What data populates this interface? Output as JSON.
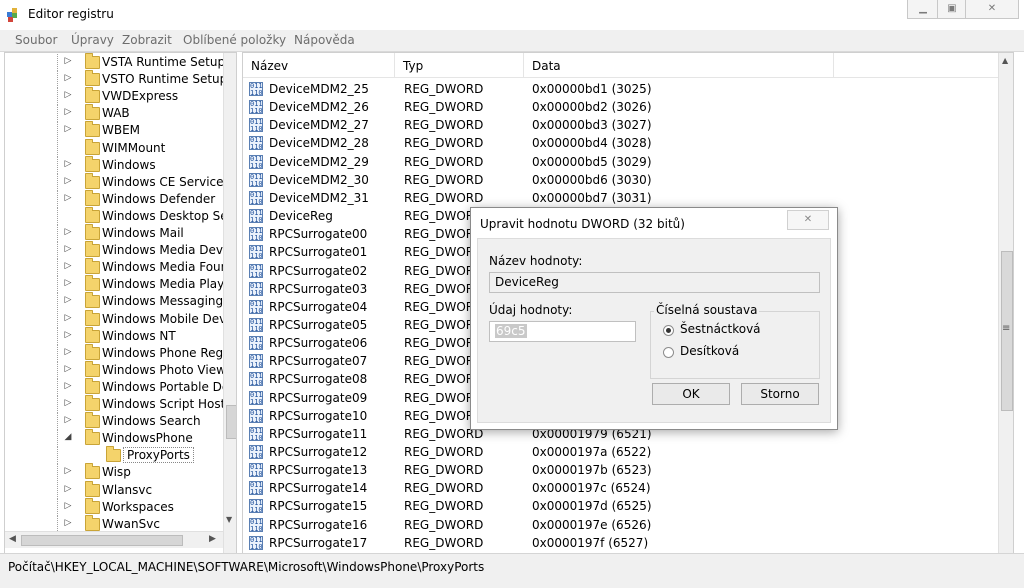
{
  "window": {
    "title": "Editor registru"
  },
  "menu": [
    "Soubor",
    "Úpravy",
    "Zobrazit",
    "Oblíbené položky",
    "Nápověda"
  ],
  "tree": {
    "items": [
      {
        "label": "VSTA Runtime Setup",
        "arrow": "▷"
      },
      {
        "label": "VSTO Runtime Setup",
        "arrow": "▷"
      },
      {
        "label": "VWDExpress",
        "arrow": "▷"
      },
      {
        "label": "WAB",
        "arrow": "▷"
      },
      {
        "label": "WBEM",
        "arrow": "▷"
      },
      {
        "label": "WIMMount",
        "arrow": ""
      },
      {
        "label": "Windows",
        "arrow": "▷"
      },
      {
        "label": "Windows CE Services",
        "arrow": "▷"
      },
      {
        "label": "Windows Defender",
        "arrow": "▷"
      },
      {
        "label": "Windows Desktop Se",
        "arrow": ""
      },
      {
        "label": "Windows Mail",
        "arrow": "▷"
      },
      {
        "label": "Windows Media Devi",
        "arrow": "▷"
      },
      {
        "label": "Windows Media Foun",
        "arrow": "▷"
      },
      {
        "label": "Windows Media Playe",
        "arrow": "▷"
      },
      {
        "label": "Windows Messaging",
        "arrow": "▷"
      },
      {
        "label": "Windows Mobile Dev",
        "arrow": "▷"
      },
      {
        "label": "Windows NT",
        "arrow": "▷"
      },
      {
        "label": "Windows Phone Reg",
        "arrow": "▷"
      },
      {
        "label": "Windows Photo View",
        "arrow": "▷"
      },
      {
        "label": "Windows Portable De",
        "arrow": "▷"
      },
      {
        "label": "Windows Script Host",
        "arrow": "▷"
      },
      {
        "label": "Windows Search",
        "arrow": "▷"
      },
      {
        "label": "WindowsPhone",
        "arrow": "◢"
      },
      {
        "label": "ProxyPorts",
        "arrow": ""
      },
      {
        "label": "Wisp",
        "arrow": "▷"
      },
      {
        "label": "Wlansvc",
        "arrow": "▷"
      },
      {
        "label": "Workspaces",
        "arrow": "▷"
      },
      {
        "label": "WwanSvc",
        "arrow": "▷"
      }
    ]
  },
  "list": {
    "columns": [
      "Název",
      "Typ",
      "Data"
    ],
    "rows": [
      {
        "name": "DeviceMDM2_25",
        "type": "REG_DWORD",
        "data": "0x00000bd1 (3025)"
      },
      {
        "name": "DeviceMDM2_26",
        "type": "REG_DWORD",
        "data": "0x00000bd2 (3026)"
      },
      {
        "name": "DeviceMDM2_27",
        "type": "REG_DWORD",
        "data": "0x00000bd3 (3027)"
      },
      {
        "name": "DeviceMDM2_28",
        "type": "REG_DWORD",
        "data": "0x00000bd4 (3028)"
      },
      {
        "name": "DeviceMDM2_29",
        "type": "REG_DWORD",
        "data": "0x00000bd5 (3029)"
      },
      {
        "name": "DeviceMDM2_30",
        "type": "REG_DWORD",
        "data": "0x00000bd6 (3030)"
      },
      {
        "name": "DeviceMDM2_31",
        "type": "REG_DWORD",
        "data": "0x00000bd7 (3031)"
      },
      {
        "name": "DeviceReg",
        "type": "REG_DWORD",
        "data": ""
      },
      {
        "name": "RPCSurrogate00",
        "type": "REG_DWORD",
        "data": ""
      },
      {
        "name": "RPCSurrogate01",
        "type": "REG_DWORD",
        "data": ""
      },
      {
        "name": "RPCSurrogate02",
        "type": "REG_DWORD",
        "data": ""
      },
      {
        "name": "RPCSurrogate03",
        "type": "REG_DWORD",
        "data": ""
      },
      {
        "name": "RPCSurrogate04",
        "type": "REG_DWORD",
        "data": ""
      },
      {
        "name": "RPCSurrogate05",
        "type": "REG_DWORD",
        "data": ""
      },
      {
        "name": "RPCSurrogate06",
        "type": "REG_DWORD",
        "data": ""
      },
      {
        "name": "RPCSurrogate07",
        "type": "REG_DWORD",
        "data": ""
      },
      {
        "name": "RPCSurrogate08",
        "type": "REG_DWORD",
        "data": ""
      },
      {
        "name": "RPCSurrogate09",
        "type": "REG_DWORD",
        "data": ""
      },
      {
        "name": "RPCSurrogate10",
        "type": "REG_DWORD",
        "data": ""
      },
      {
        "name": "RPCSurrogate11",
        "type": "REG_DWORD",
        "data": "0x00001979 (6521)"
      },
      {
        "name": "RPCSurrogate12",
        "type": "REG_DWORD",
        "data": "0x0000197a (6522)"
      },
      {
        "name": "RPCSurrogate13",
        "type": "REG_DWORD",
        "data": "0x0000197b (6523)"
      },
      {
        "name": "RPCSurrogate14",
        "type": "REG_DWORD",
        "data": "0x0000197c (6524)"
      },
      {
        "name": "RPCSurrogate15",
        "type": "REG_DWORD",
        "data": "0x0000197d (6525)"
      },
      {
        "name": "RPCSurrogate16",
        "type": "REG_DWORD",
        "data": "0x0000197e (6526)"
      },
      {
        "name": "RPCSurrogate17",
        "type": "REG_DWORD",
        "data": "0x0000197f (6527)"
      }
    ]
  },
  "status": {
    "path": "Počítač\\HKEY_LOCAL_MACHINE\\SOFTWARE\\Microsoft\\WindowsPhone\\ProxyPorts"
  },
  "dialog": {
    "title": "Upravit hodnotu DWORD (32 bitů)",
    "name_label": "Název hodnoty:",
    "name_value": "DeviceReg",
    "data_label": "Údaj hodnoty:",
    "data_value": "69c5",
    "base_label": "Číselná soustava",
    "hex_label": "Šestnáctková",
    "dec_label": "Desítková",
    "ok_label": "OK",
    "cancel_label": "Storno"
  },
  "colors": {
    "folder": "#f4d36b",
    "reg_icon": "#1d4f9a",
    "menu_text": "#6d6d6d"
  }
}
